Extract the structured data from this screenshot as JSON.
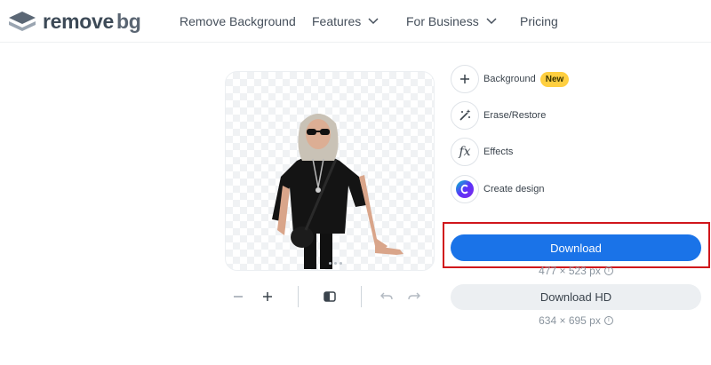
{
  "brand": {
    "name_part1": "remove",
    "name_part2": "bg"
  },
  "nav": {
    "remove_background": "Remove Background",
    "features": "Features",
    "for_business": "For Business",
    "pricing": "Pricing"
  },
  "tools": {
    "background": {
      "label": "Background",
      "badge": "New",
      "icon": "plus-icon"
    },
    "erase_restore": {
      "label": "Erase/Restore",
      "icon": "magic-wand-icon"
    },
    "effects": {
      "label": "Effects",
      "icon": "fx-icon",
      "glyph": "fx"
    },
    "create_design": {
      "label": "Create design",
      "icon": "canva-icon"
    }
  },
  "download": {
    "label": "Download",
    "size": "477 × 523 px",
    "hd_label": "Download HD",
    "hd_size": "634 × 695 px"
  },
  "colors": {
    "primary": "#1a73e8",
    "badge": "#ffcf40",
    "highlight": "#d0161b"
  }
}
